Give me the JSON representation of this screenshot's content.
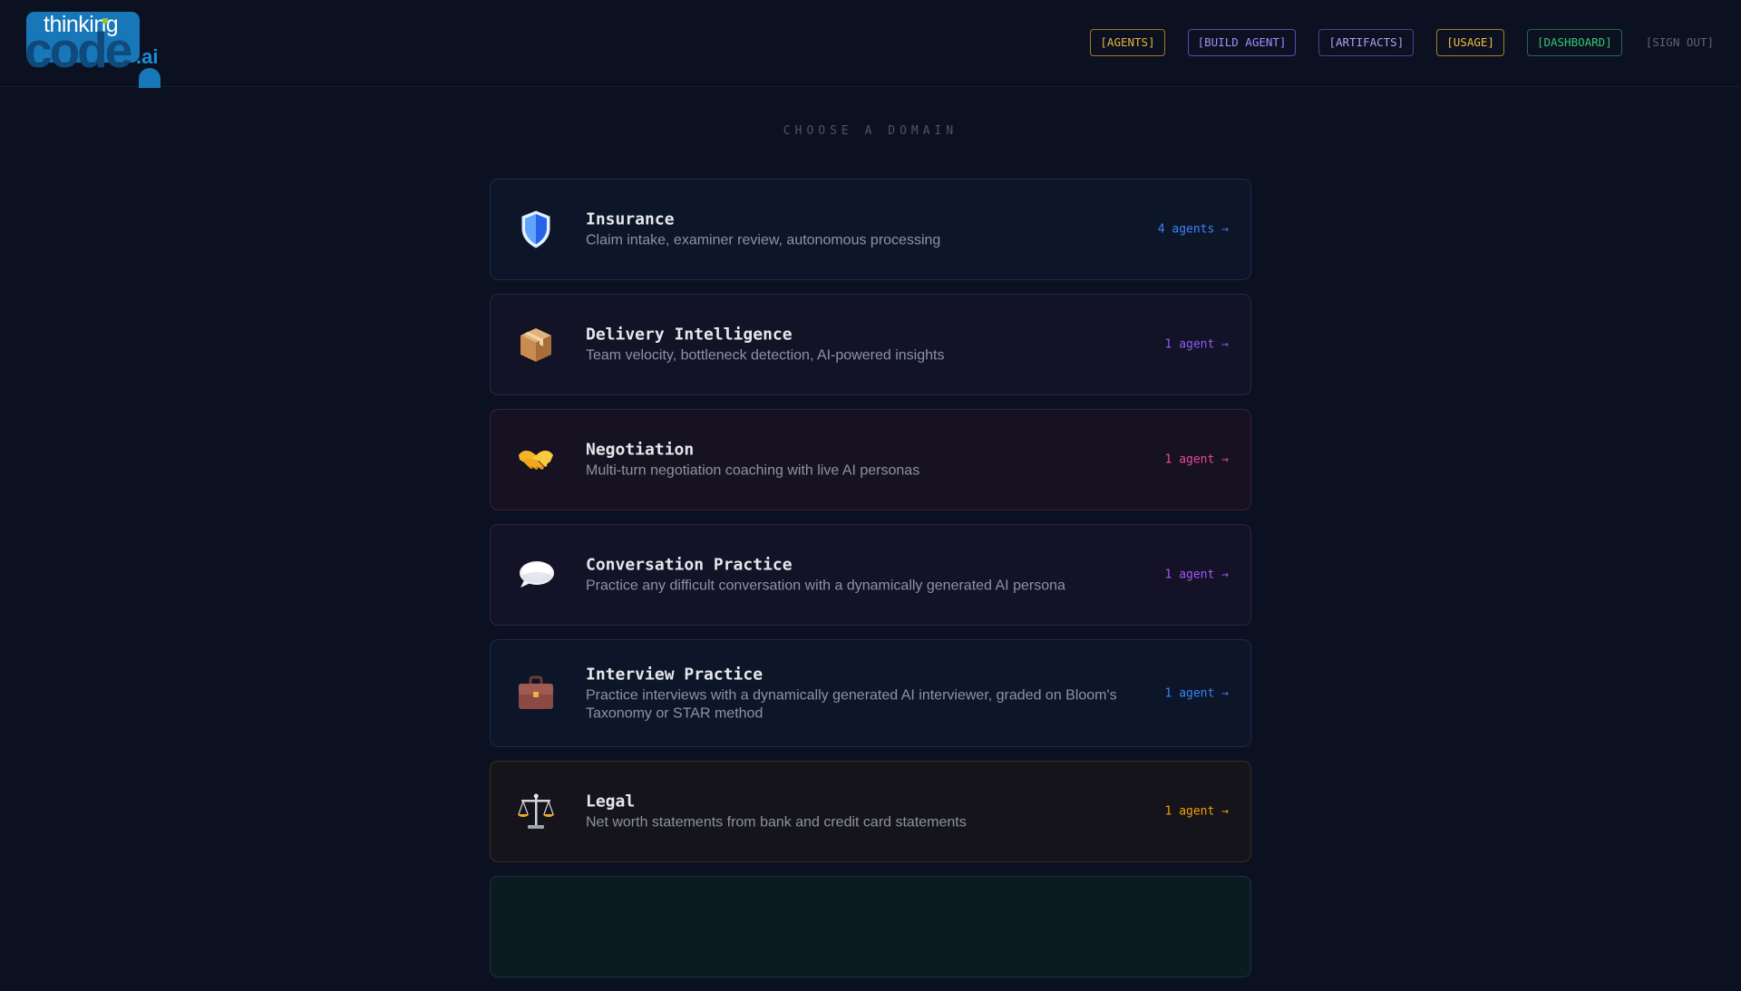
{
  "header": {
    "logo": {
      "line1": "thinking",
      "line2": "code",
      "suffix": ".ai"
    },
    "nav": [
      {
        "label": "[AGENTS]",
        "color": "#e8b53a",
        "border": "#a07a22",
        "bg": "transparent"
      },
      {
        "label": "[BUILD AGENT]",
        "color": "#a78bfa",
        "border": "#5b4bb0",
        "bg": "transparent"
      },
      {
        "label": "[ARTIFACTS]",
        "color": "#b79cf5",
        "border": "#4f3e95",
        "bg": "transparent"
      },
      {
        "label": "[USAGE]",
        "color": "#f2bf3b",
        "border": "#a67f1f",
        "bg": "transparent"
      },
      {
        "label": "[DASHBOARD]",
        "color": "#34c76f",
        "border": "#1f6b43",
        "bg": "transparent"
      },
      {
        "label": "[SIGN OUT]",
        "color": "#5b6472",
        "border": "transparent",
        "bg": "transparent"
      }
    ]
  },
  "main": {
    "heading": "CHOOSE A DOMAIN",
    "domains": [
      {
        "title": "Insurance",
        "description": "Claim intake, examiner review, autonomous processing",
        "count": "4 agents →",
        "icon": "shield-icon",
        "accent": "#3b82f6",
        "bg": "#0d1628",
        "border": "#1c2a46"
      },
      {
        "title": "Delivery Intelligence",
        "description": "Team velocity, bottleneck detection, AI-powered insights",
        "count": "1 agent →",
        "icon": "package-icon",
        "accent": "#8b5cf6",
        "bg": "#121326",
        "border": "#2a2648"
      },
      {
        "title": "Negotiation",
        "description": "Multi-turn negotiation coaching with live AI personas",
        "count": "1 agent →",
        "icon": "handshake-icon",
        "accent": "#ec4899",
        "bg": "#161222",
        "border": "#3c1f3c"
      },
      {
        "title": "Conversation Practice",
        "description": "Practice any difficult conversation with a dynamically generated AI persona",
        "count": "1 agent →",
        "icon": "speech-bubble-icon",
        "accent": "#a855f7",
        "bg": "#131227",
        "border": "#2c254a"
      },
      {
        "title": "Interview Practice",
        "description": "Practice interviews with a dynamically generated AI interviewer, graded on Bloom's Taxonomy or STAR method",
        "count": "1 agent →",
        "icon": "briefcase-icon",
        "accent": "#3b82f6",
        "bg": "#0d1628",
        "border": "#1c2a46"
      },
      {
        "title": "Legal",
        "description": "Net worth statements from bank and credit card statements",
        "count": "1 agent →",
        "icon": "scales-icon",
        "accent": "#f59e0b",
        "bg": "#15141a",
        "border": "#3a2e1c"
      },
      {
        "title": "",
        "description": "",
        "count": "",
        "icon": "",
        "accent": "#14b8a6",
        "bg": "#0c1a22",
        "border": "#15363a"
      }
    ]
  }
}
